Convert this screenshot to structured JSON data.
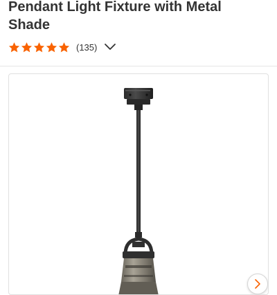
{
  "product": {
    "title_line1": "Pendant Light Fixture with Metal",
    "title_line2": "Shade"
  },
  "rating": {
    "stars": 5,
    "max_stars": 5,
    "review_count": "(135)",
    "star_color": "#f96302"
  },
  "gallery": {
    "next_icon": "chevron-right-icon",
    "expand_icon": "chevron-down-icon"
  }
}
